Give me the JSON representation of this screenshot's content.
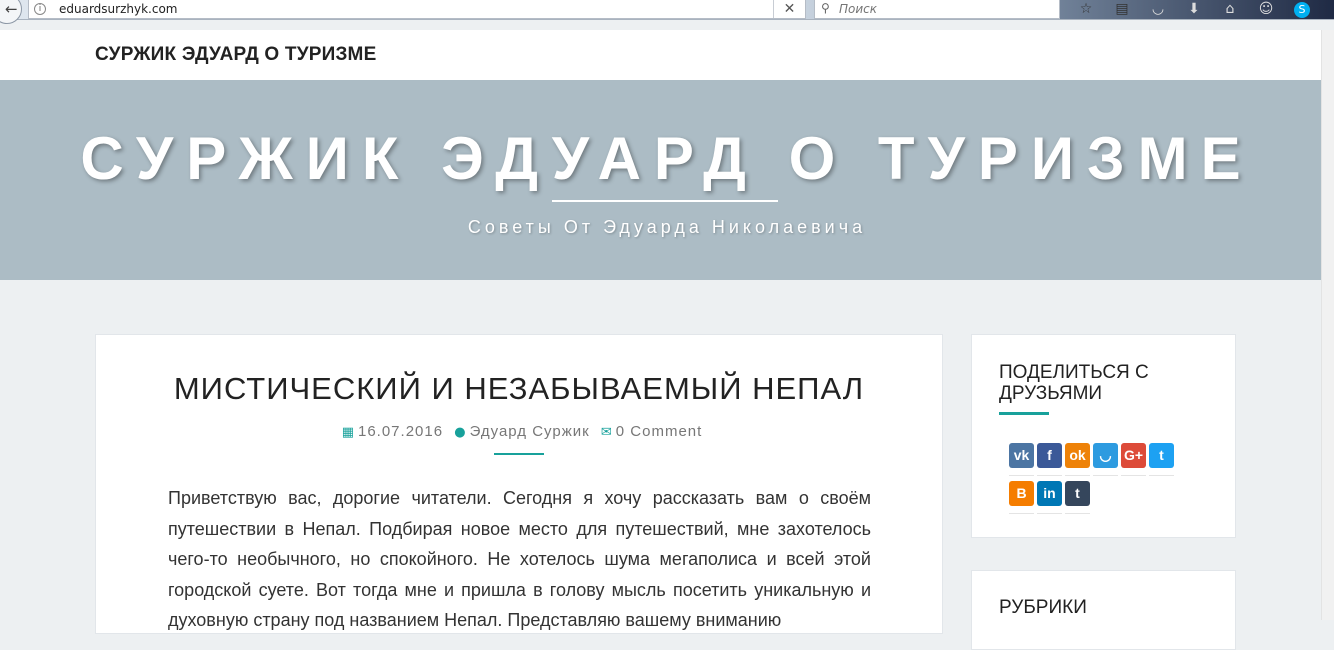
{
  "browser": {
    "url": "eduardsurzhyk.com",
    "search_placeholder": "Поиск",
    "toolbar_icons": [
      "star-icon",
      "reader-icon",
      "pocket-icon",
      "download-icon",
      "home-icon",
      "chat-icon",
      "skype-icon"
    ]
  },
  "site": {
    "brand": "СУРЖИК ЭДУАРД О ТУРИЗМЕ",
    "hero_title": "СУРЖИК ЭДУАРД О ТУРИЗМЕ",
    "tagline": "Советы От Эдуарда Николаевича"
  },
  "post": {
    "title": "МИСТИЧЕСКИЙ И НЕЗАБЫВАЕМЫЙ НЕПАЛ",
    "date": "16.07.2016",
    "author": "Эдуард Суржик",
    "comments": "0 Comment",
    "body": "Приветствую вас, дорогие читатели. Сегодня я хочу рассказать вам о своём путешествии в Непал. Подбирая новое место для путешествий, мне захотелось чего-то необычного, но спокойного. Не хотелось шума мегаполиса и всей этой городской суете. Вот тогда мне и пришла в голову мысль посетить уникальную и духовную страну под названием Непал. Представляю вашему вниманию"
  },
  "sidebar": {
    "share_title": "ПОДЕЛИТЬСЯ С ДРУЗЬЯМИ",
    "rubrics_title": "РУБРИКИ",
    "social": [
      {
        "name": "vk-icon",
        "glyph": "vk",
        "color": "#4c75a3"
      },
      {
        "name": "facebook-icon",
        "glyph": "f",
        "color": "#3b5998"
      },
      {
        "name": "odnoklassniki-icon",
        "glyph": "ok",
        "color": "#ee8208"
      },
      {
        "name": "mailru-icon",
        "glyph": "◡",
        "color": "#2d9be0"
      },
      {
        "name": "googleplus-icon",
        "glyph": "G+",
        "color": "#dd4b39"
      },
      {
        "name": "twitter-icon",
        "glyph": "t",
        "color": "#1da1f2"
      },
      {
        "name": "blogger-icon",
        "glyph": "B",
        "color": "#f57d00"
      },
      {
        "name": "linkedin-icon",
        "glyph": "in",
        "color": "#0077b5"
      },
      {
        "name": "tumblr-icon",
        "glyph": "t",
        "color": "#35465c"
      }
    ]
  }
}
